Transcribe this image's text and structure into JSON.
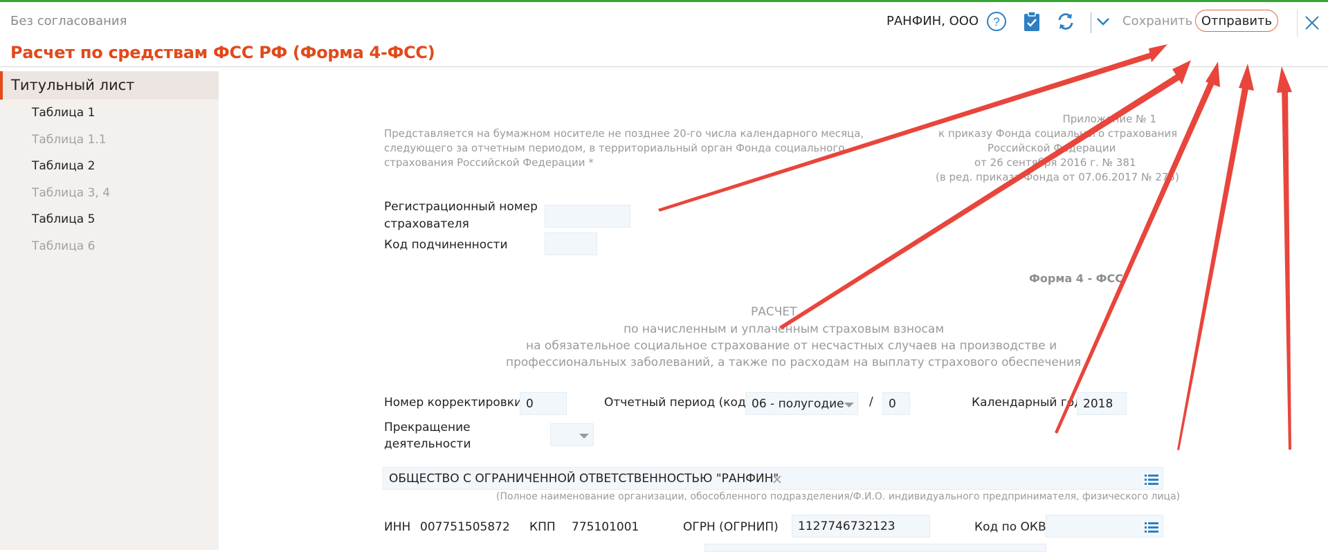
{
  "header": {
    "status": "Без согласования",
    "title": "Расчет по средствам ФСС РФ (Форма 4-ФСС)",
    "org": "РАНФИН, ООО",
    "save_label": "Сохранить",
    "send_label": "Отправить",
    "accent_color": "#e2491b",
    "topline_color": "#35a534"
  },
  "sidebar": {
    "items": [
      {
        "label": "Титульный лист",
        "state": "active"
      },
      {
        "label": "Таблица 1",
        "state": "enabled"
      },
      {
        "label": "Таблица 1.1",
        "state": "disabled"
      },
      {
        "label": "Таблица 2",
        "state": "enabled"
      },
      {
        "label": "Таблица 3, 4",
        "state": "disabled"
      },
      {
        "label": "Таблица 5",
        "state": "enabled"
      },
      {
        "label": "Таблица 6",
        "state": "disabled"
      }
    ]
  },
  "form": {
    "note_left": [
      "Представляется на бумажном носителе не позднее 20-го числа календарного месяца,",
      "следующего за отчетным периодом, в территориальный орган Фонда социального",
      "страхования Российской Федерации *"
    ],
    "note_right": [
      "Приложение № 1",
      "к приказу Фонда социального страхования",
      "Российской Федерации",
      "от 26 сентября 2016 г. № 381",
      "(в ред. приказа Фонда от 07.06.2017 № 275)"
    ],
    "reg_number_label_1": "Регистрационный номер",
    "reg_number_label_2": "страхователя",
    "reg_number_value": "",
    "subordination_label": "Код подчиненности",
    "subordination_value": "",
    "form_code": "Форма 4 - ФСС",
    "calc_title": [
      "РАСЧЕТ",
      "по начисленным и уплаченным страховым взносам",
      "на обязательное социальное страхование от несчастных случаев на производстве и",
      "профессиональных заболеваний, а также по расходам на выплату страхового обеспечения"
    ],
    "correction_label": "Номер корректировки",
    "correction_value": "0",
    "period_label": "Отчетный период (код)",
    "period_value": "06 - полугодие",
    "period_slash": "/",
    "period_extra_value": "0",
    "year_label": "Календарный год",
    "year_value": "2018",
    "termination_label_1": "Прекращение",
    "termination_label_2": "деятельности",
    "termination_value": "",
    "org_name_value": "ОБЩЕСТВО С ОГРАНИЧЕННОЙ ОТВЕТСТВЕННОСТЬЮ \"РАНФИН\"",
    "org_name_hint": "(Полное наименование организации, обособленного подразделения/Ф.И.О. индивидуального предпринимателя, физического лица)",
    "inn_label": "ИНН",
    "inn_value": "007751505872",
    "kpp_label": "КПП",
    "kpp_value": "775101001",
    "ogrn_label": "ОГРН (ОГРНИП)",
    "ogrn_value": "1127746732123",
    "okved_label": "Код по ОКВЭД",
    "okved_value": ""
  },
  "icons": [
    "help-icon",
    "clipboard-check-icon",
    "refresh-icon",
    "chevron-down-icon",
    "close-icon",
    "list-icon",
    "clear-x-icon",
    "dropdown-arrow-icon"
  ],
  "annotation": {
    "arrow_color": "#e8453c"
  }
}
